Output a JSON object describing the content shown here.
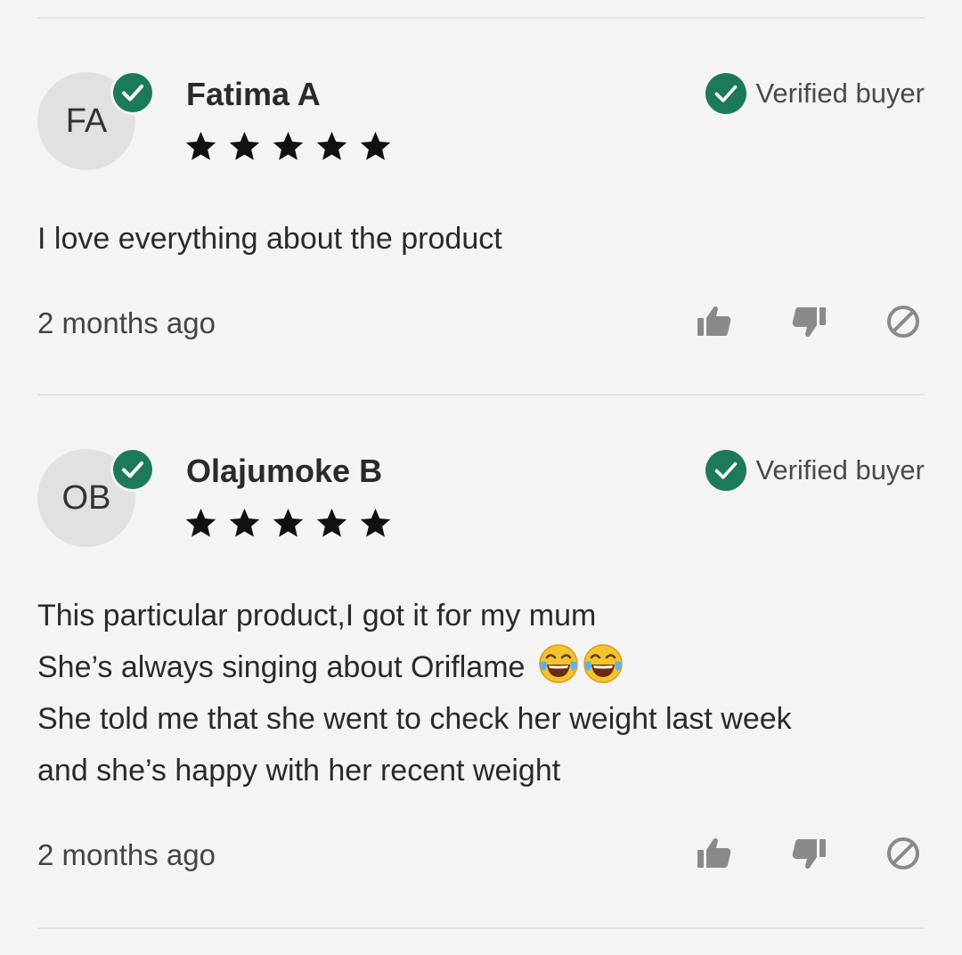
{
  "reviews": [
    {
      "initials": "FA",
      "name": "Fatima A",
      "rating": 5,
      "verified_label": "Verified buyer",
      "body": [
        "I love everything about the product"
      ],
      "emojis": [],
      "date": "2 months ago"
    },
    {
      "initials": "OB",
      "name": "Olajumoke B",
      "rating": 5,
      "verified_label": "Verified buyer",
      "body": [
        "This particular product,I got it for my mum",
        "She’s always singing about Oriflame",
        "She told me that she went to check her weight last week",
        "and she’s happy with her recent weight"
      ],
      "emojis": [
        "face-with-tears-of-joy",
        "face-with-tears-of-joy"
      ],
      "date": "2 months ago"
    }
  ],
  "icons": {
    "verified": "check-circle-icon",
    "star": "star-icon",
    "like": "thumbs-up-icon",
    "dislike": "thumbs-down-icon",
    "report": "report-icon"
  },
  "colors": {
    "background": "#f4f4f4",
    "verified_green": "#1c7a5a",
    "star": "#111111",
    "action_icon": "#8a8a8a",
    "avatar_bg": "#e1e1e1"
  }
}
